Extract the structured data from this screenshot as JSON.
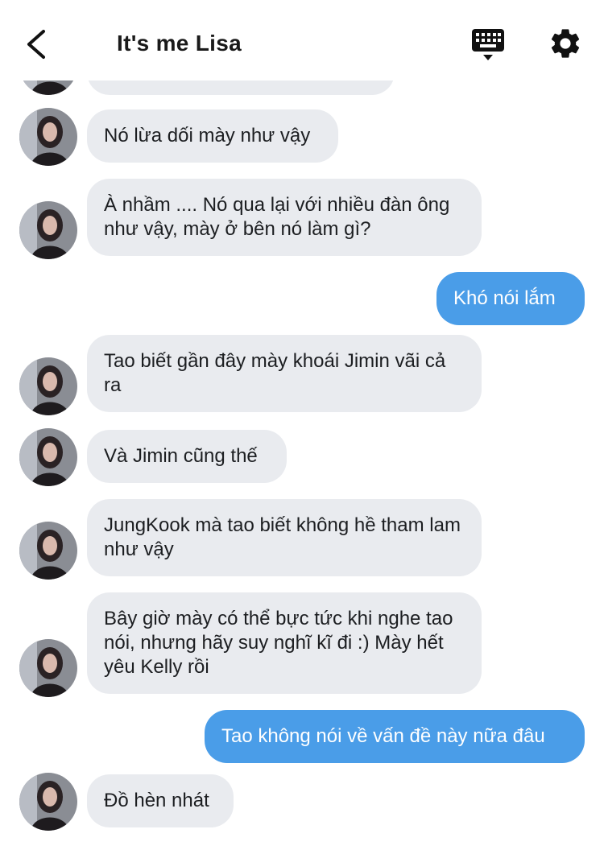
{
  "header": {
    "title": "It's me Lisa",
    "back_icon": "chevron-left-icon",
    "keyboard_icon": "keyboard-icon",
    "settings_icon": "gear-icon"
  },
  "colors": {
    "incoming_bubble": "#e9ebef",
    "outgoing_bubble": "#4a9de8"
  },
  "messages": [
    {
      "sender": "contact",
      "text": "Nó lừa dối mày như vậy"
    },
    {
      "sender": "contact",
      "text": "À nhầm .... Nó qua lại với nhiều đàn ông như vậy, mày ở bên nó làm gì?"
    },
    {
      "sender": "me",
      "text": "Khó nói lắm"
    },
    {
      "sender": "contact",
      "text": "Tao biết gần đây mày khoái Jimin vãi cả ra"
    },
    {
      "sender": "contact",
      "text": "Và Jimin cũng thế"
    },
    {
      "sender": "contact",
      "text": "JungKook mà tao biết không hề tham lam như vậy"
    },
    {
      "sender": "contact",
      "text": "Bây giờ mày có thể bực tức khi nghe tao nói, nhưng hãy suy nghĩ kĩ đi :) Mày hết yêu Kelly rồi"
    },
    {
      "sender": "me",
      "text": "Tao không nói về vấn đề này nữa đâu"
    },
    {
      "sender": "contact",
      "text": "Đồ hèn nhát"
    }
  ]
}
